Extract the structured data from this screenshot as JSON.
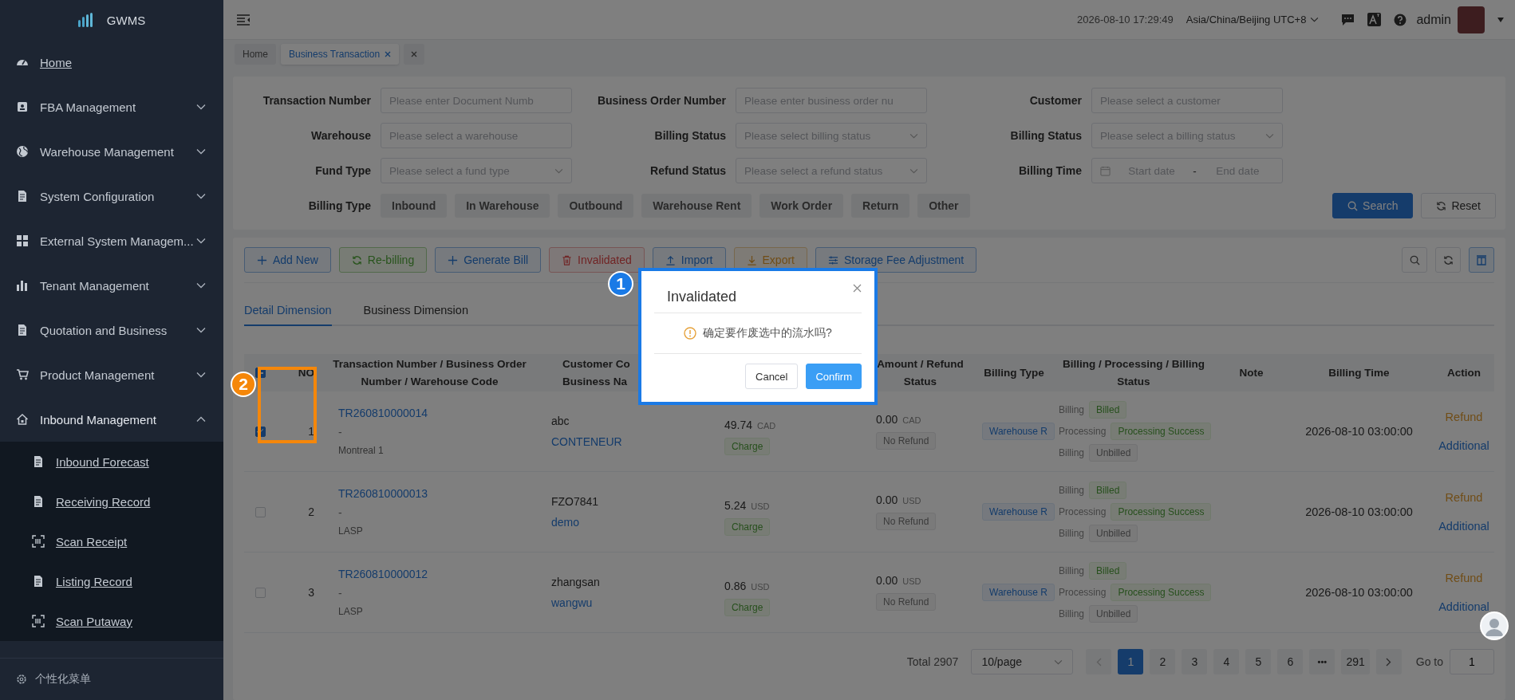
{
  "sidebar": {
    "logo": "GWMS",
    "items": [
      {
        "label": "Home",
        "has_children": false
      },
      {
        "label": "FBA Management",
        "has_children": true,
        "expanded": false
      },
      {
        "label": "Warehouse Management",
        "has_children": true,
        "expanded": false
      },
      {
        "label": "System Configuration",
        "has_children": true,
        "expanded": false
      },
      {
        "label": "External System Managem...",
        "has_children": true,
        "expanded": false
      },
      {
        "label": "Tenant Management",
        "has_children": true,
        "expanded": false
      },
      {
        "label": "Quotation and Business",
        "has_children": true,
        "expanded": false
      },
      {
        "label": "Product Management",
        "has_children": true,
        "expanded": false
      },
      {
        "label": "Inbound Management",
        "has_children": true,
        "expanded": true,
        "children": [
          {
            "label": "Inbound Forecast"
          },
          {
            "label": "Receiving Record"
          },
          {
            "label": "Scan Receipt"
          },
          {
            "label": "Listing Record"
          },
          {
            "label": "Scan Putaway"
          }
        ]
      }
    ],
    "footer": "个性化菜单"
  },
  "header": {
    "datetime": "2026-08-10 17:29:49",
    "timezone": "Asia/China/Beijing UTC+8",
    "user": "admin"
  },
  "tags": [
    {
      "label": "Home",
      "selected": false,
      "closable": false
    },
    {
      "label": "Business Transaction",
      "selected": true,
      "closable": true
    }
  ],
  "filters": [
    {
      "label": "Transaction Number",
      "kind": "input",
      "placeholder": "Please enter Document Numb"
    },
    {
      "label": "Business Order Number",
      "kind": "input",
      "placeholder": "Please enter business order nu"
    },
    {
      "label": "Customer",
      "kind": "input",
      "placeholder": "Please select a customer"
    },
    {
      "label": "Warehouse",
      "kind": "input",
      "placeholder": "Please select a warehouse"
    },
    {
      "label": "Billing Status",
      "kind": "select",
      "placeholder": "Please select billing status"
    },
    {
      "label": "Billing Status",
      "kind": "select",
      "placeholder": "Please select a billing status"
    },
    {
      "label": "Fund Type",
      "kind": "select",
      "placeholder": "Please select a fund type"
    },
    {
      "label": "Refund Status",
      "kind": "select",
      "placeholder": "Please select a refund status"
    },
    {
      "label": "Billing Time",
      "kind": "daterange",
      "start_placeholder": "Start date",
      "separator": "-",
      "end_placeholder": "End date"
    }
  ],
  "billing_type": {
    "label": "Billing Type",
    "options": [
      {
        "label": "Inbound",
        "selected": false
      },
      {
        "label": "In Warehouse",
        "selected": false
      },
      {
        "label": "Outbound",
        "selected": false
      },
      {
        "label": "Warehouse Rent",
        "selected": false
      },
      {
        "label": "Work Order",
        "selected": false
      },
      {
        "label": "Return",
        "selected": false
      },
      {
        "label": "Other",
        "selected": false
      }
    ]
  },
  "search_button": "Search",
  "reset_button": "Reset",
  "toolbar": [
    {
      "label": "Add New",
      "kind": "primary"
    },
    {
      "label": "Re-billing",
      "kind": "success"
    },
    {
      "label": "Generate Bill",
      "kind": "primary"
    },
    {
      "label": "Invalidated",
      "kind": "danger"
    },
    {
      "label": "Import",
      "kind": "primary"
    },
    {
      "label": "Export",
      "kind": "warning"
    },
    {
      "label": "Storage Fee Adjustment",
      "kind": "primary"
    }
  ],
  "view_tabs": [
    {
      "label": "Detail Dimension",
      "selected": true
    },
    {
      "label": "Business Dimension",
      "selected": false
    }
  ],
  "table": {
    "select_all": {
      "indeterminate": true
    },
    "columns": [
      {
        "title": "NO"
      },
      {
        "title": "Transaction Number / Business Order Number / Warehouse Code"
      },
      {
        "title": "Customer Co",
        "subtitle": "Business Na"
      },
      {
        "title": "Amount / Refund Status"
      },
      {
        "title": "Billing Type"
      },
      {
        "title": "Billing / Processing / Billing Status"
      },
      {
        "title": "Note"
      },
      {
        "title": "Billing Time"
      },
      {
        "title": "Action"
      }
    ],
    "rows": [
      {
        "no": "1",
        "selected": true,
        "transaction_number": "TR260810000014",
        "order_number": "-",
        "warehouse_code": "Montreal 1",
        "customer_code": "abc",
        "business_name": "CONTENEUR",
        "amount": "49.74",
        "currency": "CAD",
        "amount_type": "Charge",
        "refund_amount": "0.00",
        "refund_currency": "CAD",
        "refund_status": "No Refund",
        "billing_type": "Warehouse R",
        "statuses": [
          {
            "label": "Billing",
            "value": "Billed",
            "kind": "success"
          },
          {
            "label": "Processing",
            "value": "Processing Success",
            "kind": "success"
          },
          {
            "label": "Billing",
            "value": "Unbilled",
            "kind": "info"
          }
        ],
        "billing_time": "2026-08-10 03:00:00",
        "actions": [
          {
            "label": "Refund",
            "kind": "warning"
          },
          {
            "label": "Additional",
            "kind": "primary"
          }
        ]
      },
      {
        "no": "2",
        "selected": false,
        "transaction_number": "TR260810000013",
        "order_number": "-",
        "warehouse_code": "LASP",
        "customer_code": "FZO7841",
        "business_name": "demo",
        "amount": "5.24",
        "currency": "USD",
        "amount_type": "Charge",
        "refund_amount": "0.00",
        "refund_currency": "USD",
        "refund_status": "No Refund",
        "billing_type": "Warehouse R",
        "statuses": [
          {
            "label": "Billing",
            "value": "Billed",
            "kind": "success"
          },
          {
            "label": "Processing",
            "value": "Processing Success",
            "kind": "success"
          },
          {
            "label": "Billing",
            "value": "Unbilled",
            "kind": "info"
          }
        ],
        "billing_time": "2026-08-10 03:00:00",
        "actions": [
          {
            "label": "Refund",
            "kind": "warning"
          },
          {
            "label": "Additional",
            "kind": "primary"
          }
        ]
      },
      {
        "no": "3",
        "selected": false,
        "transaction_number": "TR260810000012",
        "order_number": "-",
        "warehouse_code": "LASP",
        "customer_code": "zhangsan",
        "business_name": "wangwu",
        "amount": "0.86",
        "currency": "USD",
        "amount_type": "Charge",
        "refund_amount": "0.00",
        "refund_currency": "USD",
        "refund_status": "No Refund",
        "billing_type": "Warehouse R",
        "statuses": [
          {
            "label": "Billing",
            "value": "Billed",
            "kind": "success"
          },
          {
            "label": "Processing",
            "value": "Processing Success",
            "kind": "success"
          },
          {
            "label": "Billing",
            "value": "Unbilled",
            "kind": "info"
          }
        ],
        "billing_time": "2026-08-10 03:00:00",
        "actions": [
          {
            "label": "Refund",
            "kind": "warning"
          },
          {
            "label": "Additional",
            "kind": "primary"
          }
        ]
      }
    ]
  },
  "pagination": {
    "total": "Total 2907",
    "page_size": "10/page",
    "pages": [
      {
        "label": "1",
        "kind": "page",
        "selected": true
      },
      {
        "label": "2",
        "kind": "page",
        "selected": false
      },
      {
        "label": "3",
        "kind": "page",
        "selected": false
      },
      {
        "label": "4",
        "kind": "page",
        "selected": false
      },
      {
        "label": "5",
        "kind": "page",
        "selected": false
      },
      {
        "label": "6",
        "kind": "page",
        "selected": false
      },
      {
        "label": "•••",
        "kind": "ellipsis",
        "selected": false
      },
      {
        "label": "291",
        "kind": "page",
        "selected": false
      }
    ],
    "goto_label": "Go to",
    "goto_value": "1"
  },
  "dialog": {
    "title": "Invalidated",
    "message": "确定要作废选中的流水吗?",
    "cancel": "Cancel",
    "confirm": "Confirm"
  },
  "annotations": [
    {
      "label": "1",
      "color": "#1a7ae6"
    },
    {
      "label": "2",
      "color": "#f5870a"
    }
  ]
}
